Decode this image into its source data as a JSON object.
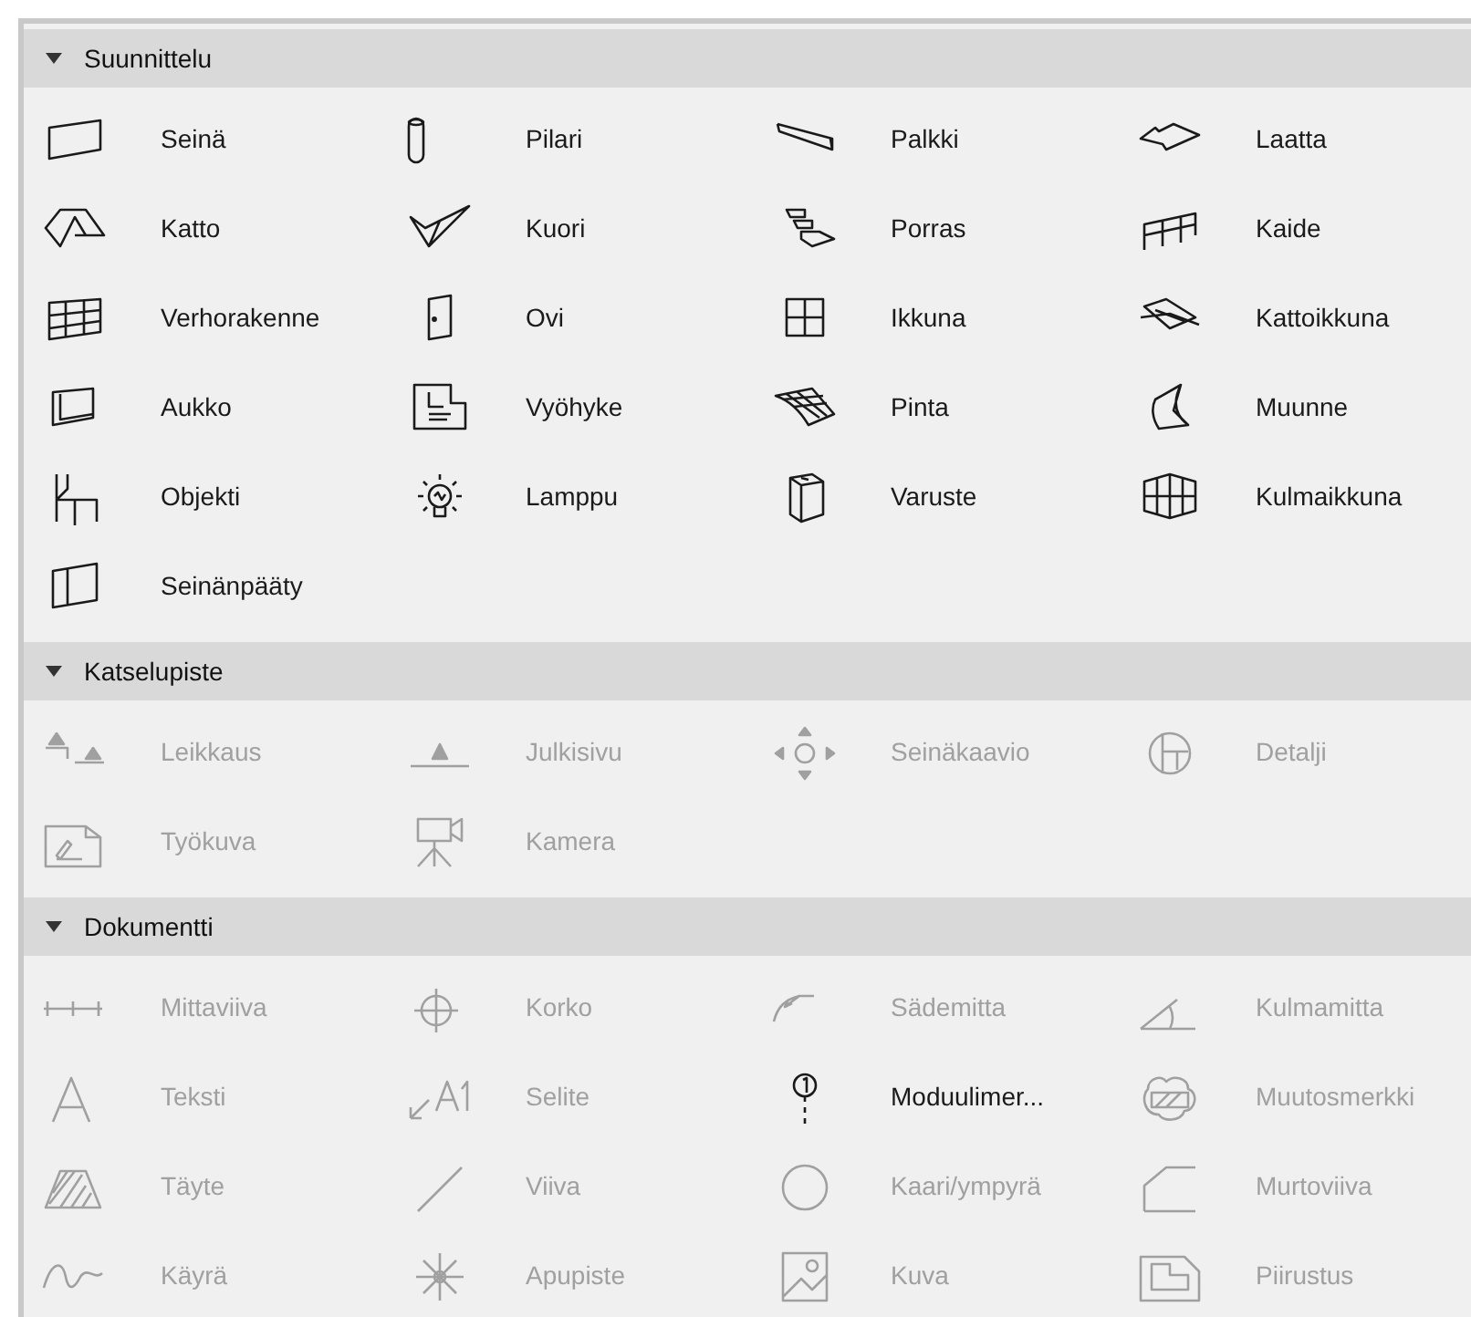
{
  "sections": [
    {
      "title": "Suunnittelu",
      "expanded": true,
      "items": [
        {
          "label": "Seinä",
          "disabled": false
        },
        {
          "label": "Pilari",
          "disabled": false
        },
        {
          "label": "Palkki",
          "disabled": false
        },
        {
          "label": "Laatta",
          "disabled": false
        },
        {
          "label": "Katto",
          "disabled": false
        },
        {
          "label": "Kuori",
          "disabled": false
        },
        {
          "label": "Porras",
          "disabled": false
        },
        {
          "label": "Kaide",
          "disabled": false
        },
        {
          "label": "Verhorakenne",
          "disabled": false
        },
        {
          "label": "Ovi",
          "disabled": false
        },
        {
          "label": "Ikkuna",
          "disabled": false
        },
        {
          "label": "Kattoikkuna",
          "disabled": false
        },
        {
          "label": "Aukko",
          "disabled": false
        },
        {
          "label": "Vyöhyke",
          "disabled": false
        },
        {
          "label": "Pinta",
          "disabled": false
        },
        {
          "label": "Muunne",
          "disabled": false
        },
        {
          "label": "Objekti",
          "disabled": false
        },
        {
          "label": "Lamppu",
          "disabled": false
        },
        {
          "label": "Varuste",
          "disabled": false
        },
        {
          "label": "Kulmaikkuna",
          "disabled": false
        },
        {
          "label": "Seinänpääty",
          "disabled": false
        }
      ]
    },
    {
      "title": "Katselupiste",
      "expanded": true,
      "items": [
        {
          "label": "Leikkaus",
          "disabled": true
        },
        {
          "label": "Julkisivu",
          "disabled": true
        },
        {
          "label": "Seinäkaavio",
          "disabled": true
        },
        {
          "label": "Detalji",
          "disabled": true
        },
        {
          "label": "Työkuva",
          "disabled": true
        },
        {
          "label": "Kamera",
          "disabled": true
        }
      ]
    },
    {
      "title": "Dokumentti",
      "expanded": true,
      "items": [
        {
          "label": "Mittaviiva",
          "disabled": true
        },
        {
          "label": "Korko",
          "disabled": true
        },
        {
          "label": "Sädemitta",
          "disabled": true
        },
        {
          "label": "Kulmamitta",
          "disabled": true
        },
        {
          "label": "Teksti",
          "disabled": true
        },
        {
          "label": "Selite",
          "disabled": true
        },
        {
          "label": "Moduulimer...",
          "disabled": false
        },
        {
          "label": "Muutosmerkki",
          "disabled": true
        },
        {
          "label": "Täyte",
          "disabled": true
        },
        {
          "label": "Viiva",
          "disabled": true
        },
        {
          "label": "Kaari/ympyrä",
          "disabled": true
        },
        {
          "label": "Murtoviiva",
          "disabled": true
        },
        {
          "label": "Käyrä",
          "disabled": true
        },
        {
          "label": "Apupiste",
          "disabled": true
        },
        {
          "label": "Kuva",
          "disabled": true
        },
        {
          "label": "Piirustus",
          "disabled": true
        }
      ]
    }
  ]
}
